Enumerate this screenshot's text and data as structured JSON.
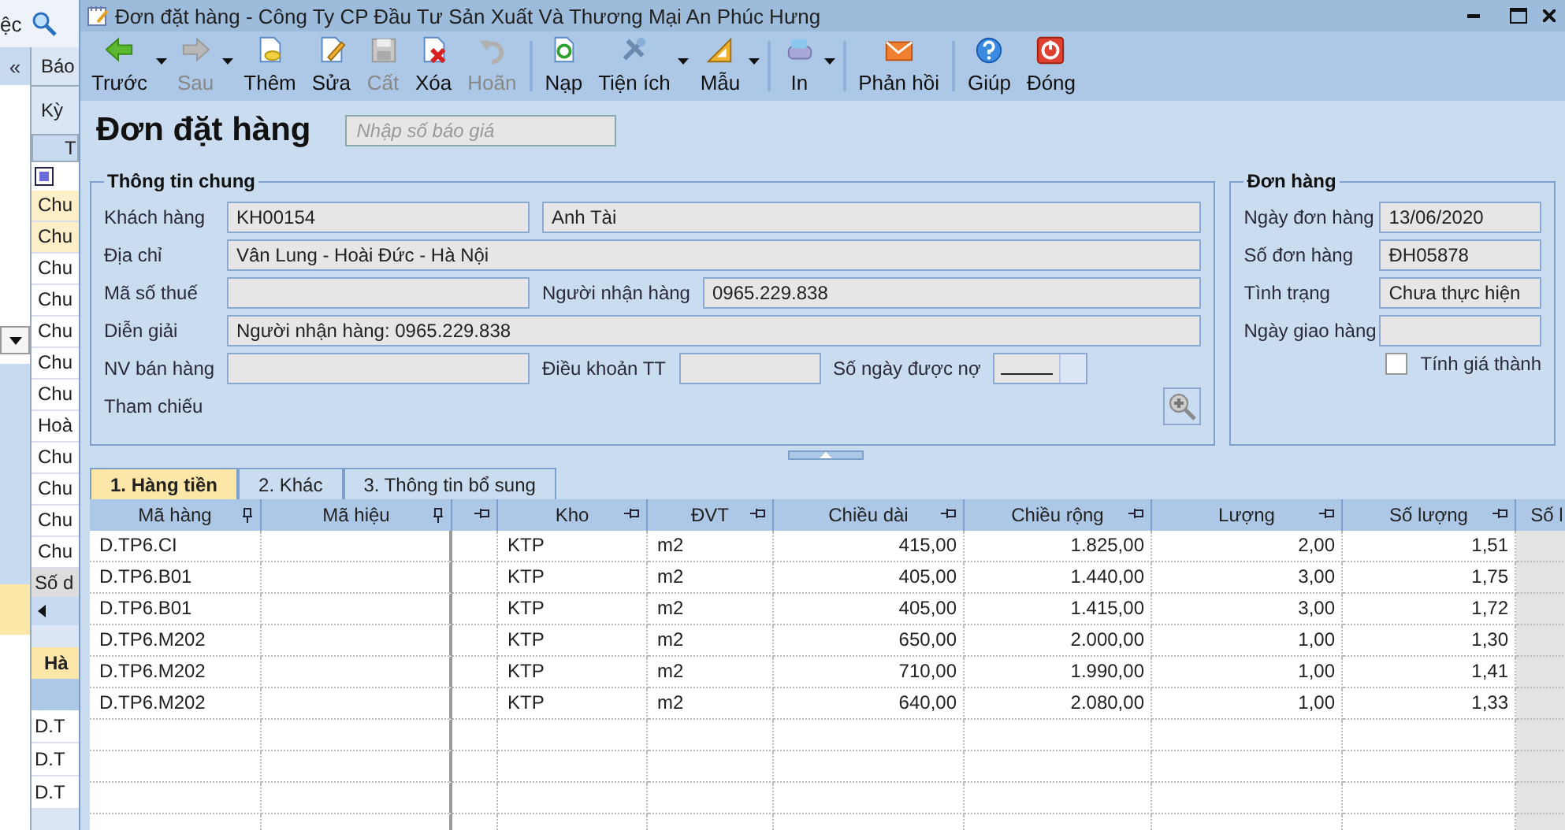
{
  "background_window": {
    "menu_text": "ệc",
    "collapse": "«",
    "tab": "Báo",
    "period_label": "Kỳ",
    "header": "T",
    "rows": [
      {
        "text": "Chu",
        "selected": true
      },
      {
        "text": "Chu",
        "selected": true
      },
      {
        "text": "Chu",
        "selected": false
      },
      {
        "text": "Chu",
        "selected": false
      },
      {
        "text": "Chu",
        "selected": false
      },
      {
        "text": "Chu",
        "selected": false
      },
      {
        "text": "Chu",
        "selected": false
      },
      {
        "text": "Hoà",
        "selected": false
      },
      {
        "text": "Chu",
        "selected": false
      },
      {
        "text": "Chu",
        "selected": false
      },
      {
        "text": "Chu",
        "selected": false
      },
      {
        "text": "Chu",
        "selected": false
      }
    ],
    "footer": "Số d",
    "detail_header": "Hà",
    "detail_rows": [
      "D.T",
      "D.T",
      "D.T"
    ]
  },
  "window": {
    "title": "Đơn đặt hàng - Công Ty CP Đầu Tư Sản Xuất Và Thương Mại An Phúc Hưng"
  },
  "toolbar": [
    {
      "kind": "button",
      "label": "Trước",
      "disabled": false,
      "dropdown": true
    },
    {
      "kind": "button",
      "label": "Sau",
      "disabled": true,
      "dropdown": true
    },
    {
      "kind": "button",
      "label": "Thêm",
      "disabled": false,
      "dropdown": false
    },
    {
      "kind": "button",
      "label": "Sửa",
      "disabled": false,
      "dropdown": false
    },
    {
      "kind": "button",
      "label": "Cất",
      "disabled": true,
      "dropdown": false
    },
    {
      "kind": "button",
      "label": "Xóa",
      "disabled": false,
      "dropdown": false
    },
    {
      "kind": "button",
      "label": "Hoãn",
      "disabled": true,
      "dropdown": false
    },
    {
      "kind": "separator"
    },
    {
      "kind": "button",
      "label": "Nạp",
      "disabled": false,
      "dropdown": false
    },
    {
      "kind": "button",
      "label": "Tiện ích",
      "disabled": false,
      "dropdown": true
    },
    {
      "kind": "button",
      "label": "Mẫu",
      "disabled": false,
      "dropdown": true
    },
    {
      "kind": "separator"
    },
    {
      "kind": "button",
      "label": "In",
      "disabled": false,
      "dropdown": true
    },
    {
      "kind": "separator"
    },
    {
      "kind": "button",
      "label": "Phản hồi",
      "disabled": false,
      "dropdown": false
    },
    {
      "kind": "separator"
    },
    {
      "kind": "button",
      "label": "Giúp",
      "disabled": false,
      "dropdown": false
    },
    {
      "kind": "button",
      "label": "Đóng",
      "disabled": false,
      "dropdown": false
    }
  ],
  "heading": {
    "title": "Đơn đặt hàng",
    "quote_field": {
      "placeholder": "Nhập số báo giá"
    }
  },
  "general": {
    "title": "Thông tin chung",
    "rows": [
      {
        "label": "Khách hàng",
        "fields": [
          {
            "kind": "text",
            "value": "KH00154"
          },
          {
            "kind": "text",
            "value": "Anh Tài"
          }
        ]
      },
      {
        "label": "Địa chỉ",
        "fields": [
          {
            "kind": "text",
            "value": "Vân Lung - Hoài Đức - Hà Nội"
          }
        ]
      },
      {
        "label": "Mã số thuế",
        "fields": [
          {
            "kind": "text"
          },
          {
            "kind": "text",
            "label": "Người nhận hàng",
            "value": "0965.229.838"
          }
        ]
      },
      {
        "label": "Diễn giải",
        "fields": [
          {
            "kind": "text",
            "value": "Người nhận hàng: 0965.229.838"
          }
        ]
      },
      {
        "label": "NV bán hàng",
        "fields": [
          {
            "kind": "text"
          },
          {
            "kind": "text",
            "label": "Điều khoản TT"
          },
          {
            "kind": "spinner",
            "label": "Số ngày được nợ"
          }
        ]
      },
      {
        "label": "Tham chiếu",
        "fields": [
          {
            "kind": "lookup"
          }
        ]
      }
    ]
  },
  "order": {
    "title": "Đơn hàng",
    "rows": [
      {
        "label": "Ngày đơn hàng",
        "value": "13/06/2020"
      },
      {
        "label": "Số đơn hàng",
        "value": "ĐH05878"
      },
      {
        "label": "Tình trạng",
        "value": "Chưa thực hiện"
      },
      {
        "label": "Ngày giao hàng"
      }
    ],
    "cost_checkbox": {
      "label": "Tính giá thành",
      "checked": false
    }
  },
  "tabs": [
    {
      "label": "1. Hàng tiền",
      "selected": true
    },
    {
      "label": "2. Khác",
      "selected": false
    },
    {
      "label": "3. Thông tin bổ sung",
      "selected": false
    }
  ],
  "table": {
    "columns": [
      {
        "label": "Mã hàng"
      },
      {
        "label": "Mã hiệu"
      },
      {},
      {
        "label": "Kho"
      },
      {
        "label": "ĐVT"
      },
      {
        "label": "Chiều dài"
      },
      {
        "label": "Chiều rộng"
      },
      {
        "label": "Lượng"
      },
      {
        "label": "Số lượng"
      },
      {
        "label": "Số l"
      }
    ],
    "rows": [
      {
        "ma_hang": "D.TP6.CI",
        "kho": "KTP",
        "dvt": "m2",
        "chieu_dai": "415,00",
        "chieu_rong": "1.825,00",
        "luong": "2,00",
        "so_luong": "1,51"
      },
      {
        "ma_hang": "D.TP6.B01",
        "kho": "KTP",
        "dvt": "m2",
        "chieu_dai": "405,00",
        "chieu_rong": "1.440,00",
        "luong": "3,00",
        "so_luong": "1,75"
      },
      {
        "ma_hang": "D.TP6.B01",
        "kho": "KTP",
        "dvt": "m2",
        "chieu_dai": "405,00",
        "chieu_rong": "1.415,00",
        "luong": "3,00",
        "so_luong": "1,72"
      },
      {
        "ma_hang": "D.TP6.M202",
        "kho": "KTP",
        "dvt": "m2",
        "chieu_dai": "650,00",
        "chieu_rong": "2.000,00",
        "luong": "1,00",
        "so_luong": "1,30"
      },
      {
        "ma_hang": "D.TP6.M202",
        "kho": "KTP",
        "dvt": "m2",
        "chieu_dai": "710,00",
        "chieu_rong": "1.990,00",
        "luong": "1,00",
        "so_luong": "1,41"
      },
      {
        "ma_hang": "D.TP6.M202",
        "kho": "KTP",
        "dvt": "m2",
        "chieu_dai": "640,00",
        "chieu_rong": "2.080,00",
        "luong": "1,00",
        "so_luong": "1,33"
      }
    ]
  }
}
